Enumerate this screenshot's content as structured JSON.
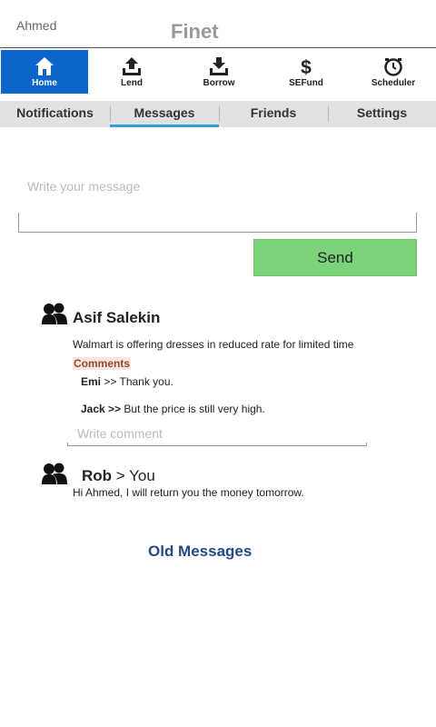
{
  "header": {
    "user_name": "Ahmed",
    "app_title": "Finet"
  },
  "nav": {
    "items": [
      {
        "label": "Home",
        "icon": "home-icon",
        "active": true
      },
      {
        "label": "Lend",
        "icon": "upload-icon"
      },
      {
        "label": "Borrow",
        "icon": "download-icon"
      },
      {
        "label": "SEFund",
        "icon": "dollar-icon"
      },
      {
        "label": "Scheduler",
        "icon": "clock-icon"
      }
    ]
  },
  "tabs": [
    {
      "label": "Notifications"
    },
    {
      "label": "Messages",
      "active": true
    },
    {
      "label": "Friends"
    },
    {
      "label": "Settings"
    }
  ],
  "composer": {
    "placeholder": "Write your message",
    "send_label": "Send"
  },
  "posts": [
    {
      "author": "Asif Salekin",
      "text": "Walmart is offering dresses in reduced rate for limited time",
      "comments_label": "Comments",
      "comments": [
        {
          "author": "Emi",
          "separator": ">>",
          "text": "Thank you."
        },
        {
          "author": "Jack >>",
          "text": "But the price is still very high."
        }
      ],
      "comment_placeholder": "Write comment"
    }
  ],
  "direct_message": {
    "from": "Rob",
    "to": "> You",
    "text": "Hi Ahmed, I will return you the money tomorrow."
  },
  "old_messages_label": "Old Messages",
  "colors": {
    "active_nav": "#0b66cc",
    "send_button": "#7bd27a",
    "tab_underline": "#2a9fd8",
    "link": "#234a86"
  }
}
